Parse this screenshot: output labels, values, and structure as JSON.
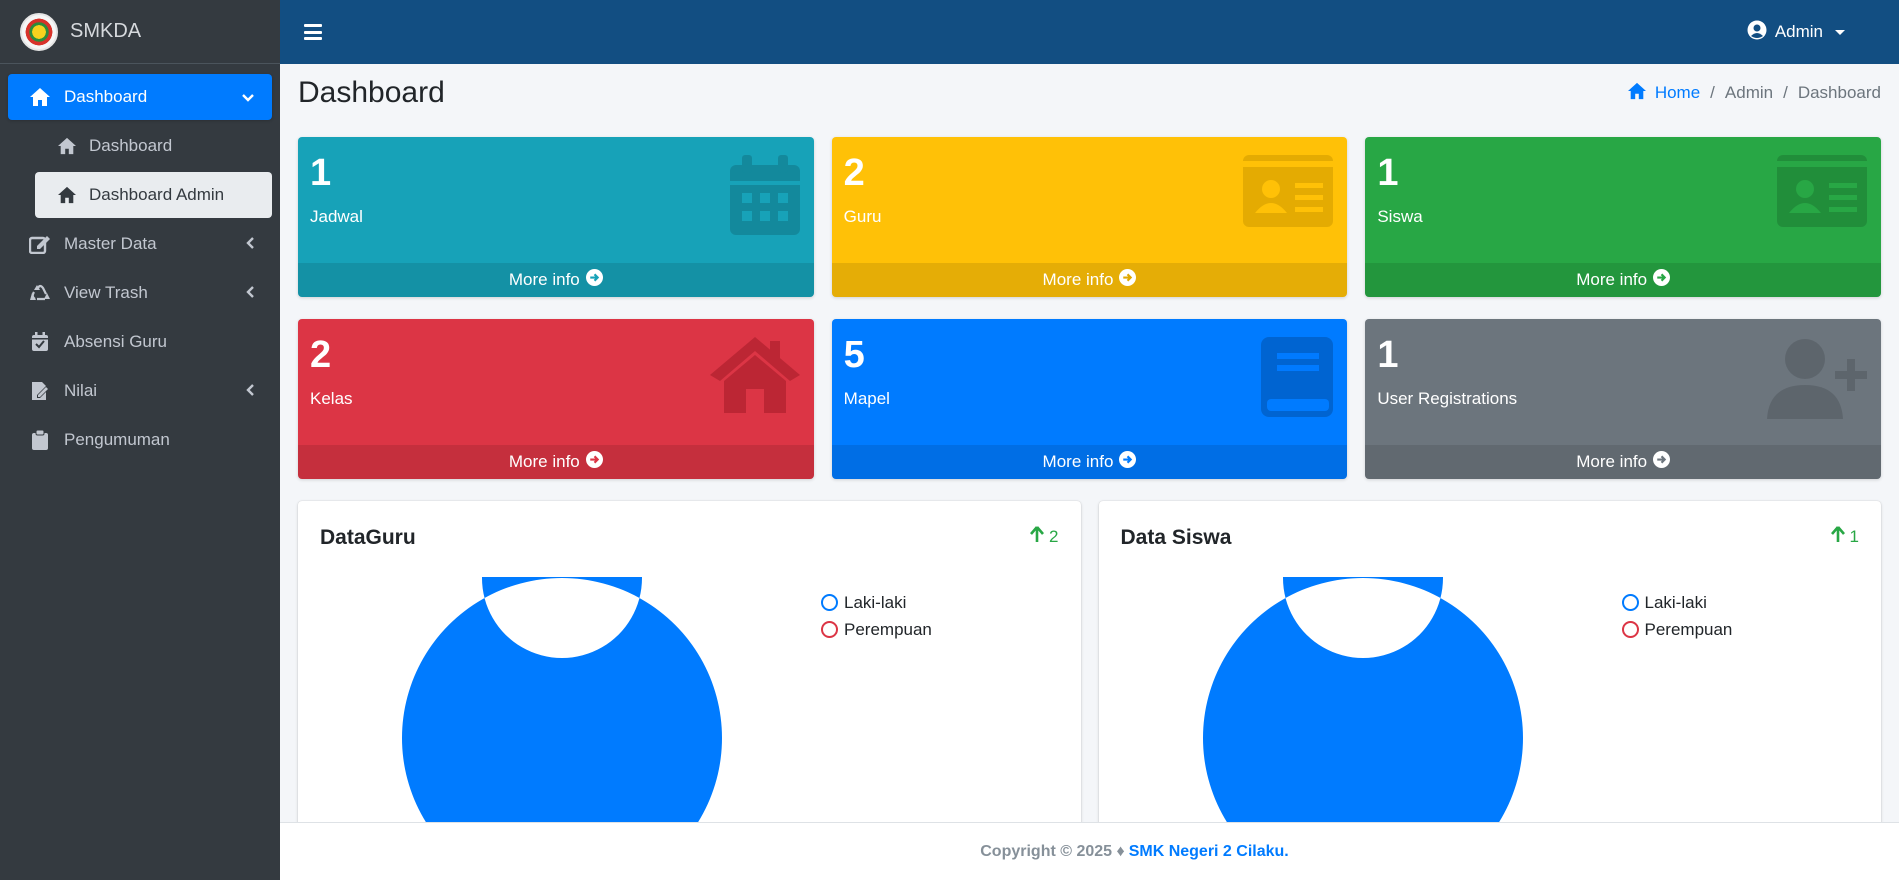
{
  "brand": {
    "name": "SMKDA"
  },
  "sidebar": {
    "items": [
      {
        "label": "Dashboard",
        "icon": "home-icon"
      },
      {
        "label": "Dashboard",
        "icon": "home-icon"
      },
      {
        "label": "Dashboard Admin",
        "icon": "home-icon"
      },
      {
        "label": "Master Data",
        "icon": "edit-icon"
      },
      {
        "label": "View Trash",
        "icon": "recycle-icon"
      },
      {
        "label": "Absensi Guru",
        "icon": "calendar-check-icon"
      },
      {
        "label": "Nilai",
        "icon": "file-edit-icon"
      },
      {
        "label": "Pengumuman",
        "icon": "clipboard-icon"
      }
    ]
  },
  "topbar": {
    "user": "Admin"
  },
  "page": {
    "title": "Dashboard",
    "breadcrumb": [
      "Home",
      "Admin",
      "Dashboard"
    ]
  },
  "boxes": [
    {
      "value": "1",
      "label": "Jadwal",
      "footer": "More info",
      "color": "#17a2b8",
      "icon": "calendar-icon"
    },
    {
      "value": "2",
      "label": "Guru",
      "footer": "More info",
      "color": "#ffc107",
      "icon": "id-card-icon"
    },
    {
      "value": "1",
      "label": "Siswa",
      "footer": "More info",
      "color": "#28a745",
      "icon": "id-card-icon"
    },
    {
      "value": "2",
      "label": "Kelas",
      "footer": "More info",
      "color": "#dc3545",
      "icon": "house-icon"
    },
    {
      "value": "5",
      "label": "Mapel",
      "footer": "More info",
      "color": "#007bff",
      "icon": "book-icon"
    },
    {
      "value": "1",
      "label": "User Registrations",
      "footer": "More info",
      "color": "#6c757d",
      "icon": "user-plus-icon"
    }
  ],
  "cards": [
    {
      "title": "DataGuru",
      "delta": "2"
    },
    {
      "title": "Data Siswa",
      "delta": "1"
    }
  ],
  "chart_data": [
    {
      "type": "pie",
      "title": "DataGuru",
      "categories": [
        "Laki-laki",
        "Perempuan"
      ],
      "values": [
        2,
        0
      ],
      "colors": [
        "#007bff",
        "#dc3545"
      ],
      "legend": "top-right"
    },
    {
      "type": "pie",
      "title": "Data Siswa",
      "categories": [
        "Laki-laki",
        "Perempuan"
      ],
      "values": [
        1,
        0
      ],
      "colors": [
        "#007bff",
        "#dc3545"
      ],
      "legend": "top-right"
    }
  ],
  "footer": {
    "prefix": "Copyright © 2025 ♦",
    "brand": "SMK Negeri 2 Cilaku."
  }
}
